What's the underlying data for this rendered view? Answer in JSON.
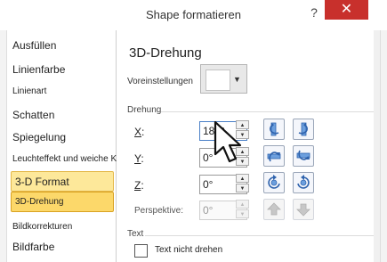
{
  "window": {
    "title": "Shape formatieren",
    "help": "?",
    "close": "✕"
  },
  "sidebar": {
    "items": [
      {
        "label": "Ausfüllen"
      },
      {
        "label": "Linienfarbe"
      },
      {
        "label": "Linienart"
      },
      {
        "label": "Schatten"
      },
      {
        "label": "Spiegelung"
      },
      {
        "label": "Leuchteffekt und weiche Kanten"
      },
      {
        "label": "3-D Format"
      },
      {
        "label": "3D-Drehung"
      },
      {
        "label": "Bildkorrekturen"
      },
      {
        "label": "Bildfarbe"
      }
    ]
  },
  "main": {
    "heading": "3D-Drehung",
    "preset_label": "Voreinstellungen",
    "rotation": {
      "title": "Drehung",
      "x": {
        "label_key": "X",
        "label_rest": ":",
        "value": "180°"
      },
      "y": {
        "label_key": "Y",
        "label_rest": ":",
        "value": "0°"
      },
      "z": {
        "label_key": "Z",
        "label_rest": ":",
        "value": "0°"
      },
      "perspective": {
        "label": "Perspektive:",
        "value": "0°"
      }
    },
    "text": {
      "title": "Text",
      "keep_flat_label": "Text nicht drehen",
      "keep_flat_checked": false
    }
  },
  "colors": {
    "close": "#c8302c",
    "selected": "#fde89a",
    "selected_border": "#e4b84a",
    "icon": "#3a73c4"
  }
}
